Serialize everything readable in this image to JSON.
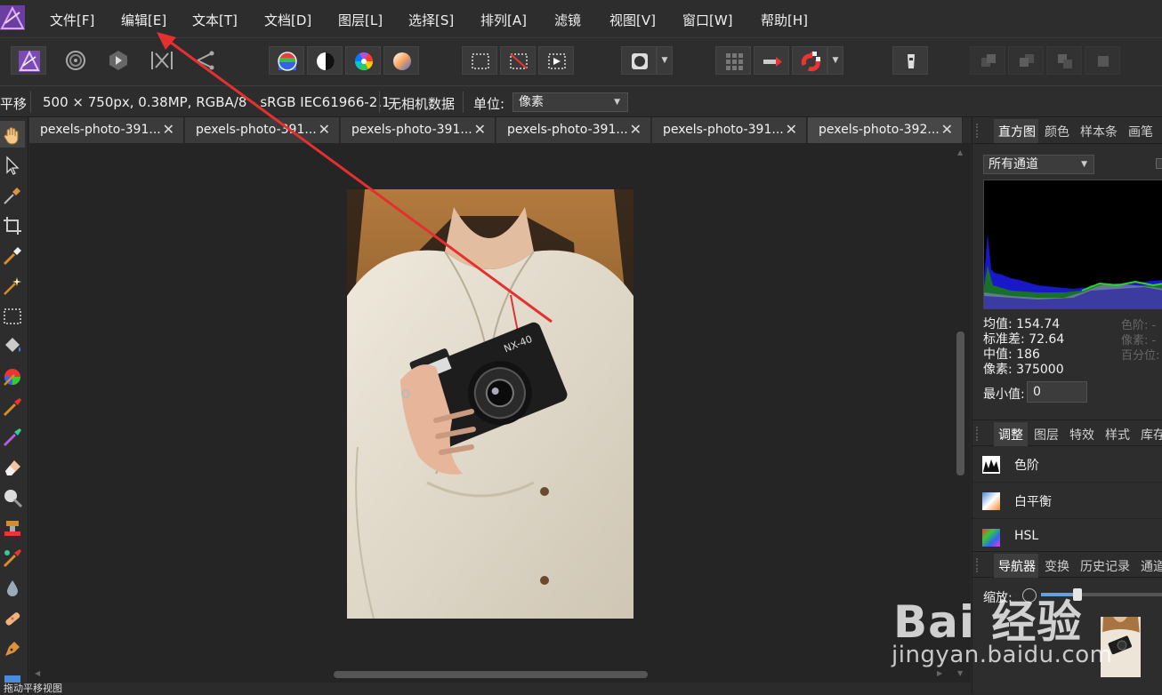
{
  "app": {
    "logo_icon": "affinity-photo-logo",
    "accent": "#a05cd8"
  },
  "menu": [
    "文件[F]",
    "编辑[E]",
    "文本[T]",
    "文档[D]",
    "图层[L]",
    "选择[S]",
    "排列[A]",
    "滤镜",
    "视图[V]",
    "窗口[W]",
    "帮助[H]"
  ],
  "toolbar": {
    "personas": [
      "photo-persona-icon",
      "liquify-persona-icon",
      "develop-persona-icon",
      "tone-mapping-persona-icon",
      "export-persona-icon"
    ],
    "color_tools": [
      "white-balance-icon",
      "contrast-icon",
      "color-wheel-icon",
      "gradient-sphere-icon"
    ],
    "selection_tools": [
      "marquee-icon",
      "deselect-icon",
      "invert-selection-icon"
    ],
    "mask_icon": "quick-mask-icon",
    "snap_tools": [
      "grid-icon",
      "force-pixel-icon",
      "snapping-magnet-icon"
    ],
    "assistant_icon": "assistant-icon",
    "arrange_tools": [
      "layer-order-1-icon",
      "layer-order-2-icon",
      "layer-order-3-icon",
      "layer-order-4-icon"
    ]
  },
  "context": {
    "tool_name": "平移",
    "doc_info": "500 × 750px, 0.38MP, RGBA/8 - sRGB IEC61966-2.1",
    "camera": "无相机数据",
    "unit_label": "单位:",
    "unit_value": "像素"
  },
  "tools": [
    "hand-icon",
    "move-icon",
    "color-picker-icon",
    "crop-icon",
    "selection-brush-icon",
    "magic-wand-icon",
    "rectangle-marquee-icon",
    "flood-fill-icon",
    "color-wheel-icon",
    "paint-brush-icon",
    "color-replace-icon",
    "erase-icon",
    "dodge-icon",
    "clone-icon",
    "healing-icon",
    "blur-icon",
    "inpainting-icon",
    "pen-icon",
    "shape-icon"
  ],
  "tabs": [
    {
      "label": "pexels-photo-391..."
    },
    {
      "label": "pexels-photo-391..."
    },
    {
      "label": "pexels-photo-391..."
    },
    {
      "label": "pexels-photo-391..."
    },
    {
      "label": "pexels-photo-391..."
    },
    {
      "label": "pexels-photo-392..."
    }
  ],
  "histogram_panel": {
    "tabs": [
      "直方图",
      "颜色",
      "样本条",
      "画笔"
    ],
    "channel": "所有通道",
    "stats": {
      "mean": "均值: 154.74",
      "std": "标准差: 72.64",
      "median": "中值: 186",
      "pixels": "像素: 375000"
    },
    "side_stats": [
      "色阶: -",
      "像素: -",
      "百分位: -"
    ],
    "min_label": "最小值:",
    "min_value": "0"
  },
  "adjust_panel": {
    "tabs": [
      "调整",
      "图层",
      "特效",
      "样式",
      "库存"
    ],
    "items": [
      "色阶",
      "白平衡",
      "HSL"
    ]
  },
  "navigator_panel": {
    "tabs": [
      "导航器",
      "变换",
      "历史记录",
      "通道"
    ],
    "zoom_label": "缩放:",
    "zoom_level": 0.3
  },
  "status": {
    "text": "拖动平移视图"
  },
  "watermark": {
    "brand": "Bai 经验",
    "url": "jingyan.baidu.com"
  }
}
